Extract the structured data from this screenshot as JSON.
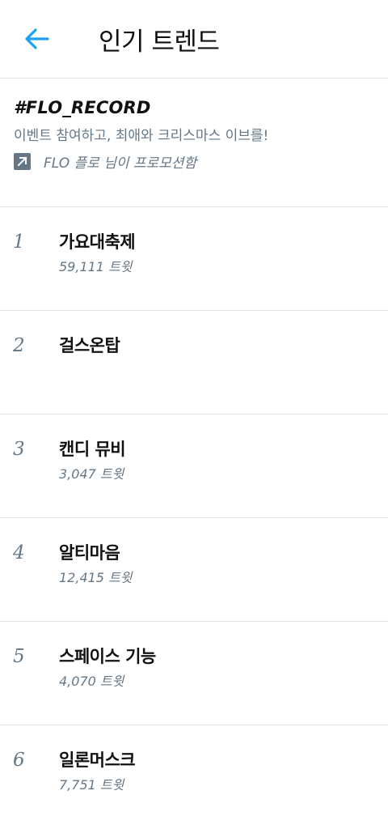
{
  "header": {
    "title": "인기 트렌드",
    "back_icon": "arrow-left-icon",
    "accent_color": "#1da1f2"
  },
  "promo": {
    "hashtag": "#FLO_RECORD",
    "description": "이벤트 참여하고, 최애와 크리스마스 이브를!",
    "promoted_by": "FLO 플로 님이 프로모션함",
    "icon": "promoted-arrow-icon"
  },
  "trends": [
    {
      "rank": "1",
      "name": "가요대축제",
      "count": "59,111 트윗"
    },
    {
      "rank": "2",
      "name": "걸스온탑",
      "count": ""
    },
    {
      "rank": "3",
      "name": "캔디 뮤비",
      "count": "3,047 트윗"
    },
    {
      "rank": "4",
      "name": "알티마음",
      "count": "12,415 트윗"
    },
    {
      "rank": "5",
      "name": "스페이스 기능",
      "count": "4,070 트윗"
    },
    {
      "rank": "6",
      "name": "일론머스크",
      "count": "7,751 트윗"
    }
  ]
}
